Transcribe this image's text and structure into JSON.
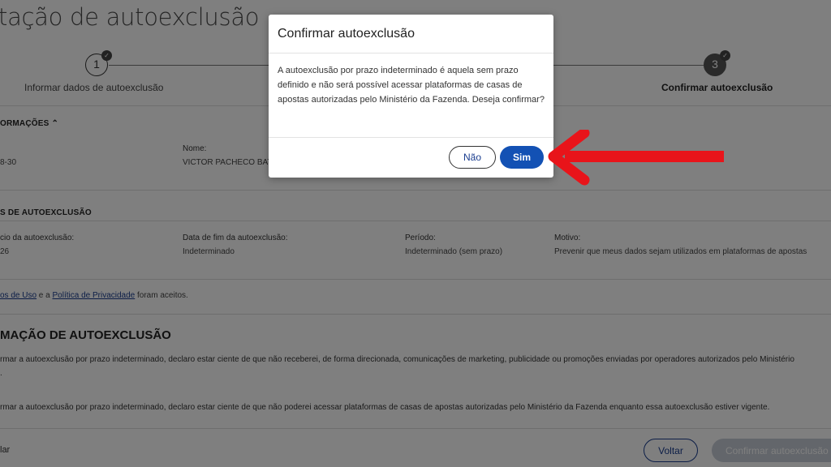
{
  "page": {
    "title": "tação de autoexclusão",
    "steps": [
      {
        "number": "1",
        "label": "Informar dados de autoexclusão"
      },
      {
        "number": "3",
        "label": "Confirmar autoexclusão"
      }
    ],
    "info_section": {
      "heading": "ORMAÇÕES",
      "fields": [
        {
          "value": "8-30"
        },
        {
          "label": "Nome:",
          "value": "VICTOR PACHECO BAT"
        }
      ]
    },
    "autoexclusion_section": {
      "heading": "S DE AUTOEXCLUSÃO",
      "fields": [
        {
          "label": "cio da autoexclusão:",
          "value": "26"
        },
        {
          "label": "Data de fim da autoexclusão:",
          "value": "Indeterminado"
        },
        {
          "label": "Período:",
          "value": "Indeterminado (sem prazo)"
        },
        {
          "label": "Motivo:",
          "value": "Prevenir que meus dados sejam utilizados em plataformas de apostas"
        }
      ]
    },
    "terms": {
      "link1": "os de Uso",
      "connector": " e a ",
      "link2": "Política de Privacidade",
      "suffix": " foram aceitos."
    },
    "declaration": {
      "heading": "MAÇÃO DE AUTOEXCLUSÃO",
      "para1_line1": "rmar a autoexclusão por prazo indeterminado, declaro estar ciente de que não receberei, de forma direcionada, comunicações de marketing, publicidade ou promoções enviadas por operadores autorizados pelo Ministério",
      "para1_line2": ".",
      "para2": "rmar a autoexclusão por prazo indeterminado, declaro estar ciente de que não poderei acessar plataformas de casas de apostas autorizadas pelo Ministério da Fazenda enquanto essa autoexclusão estiver vigente."
    },
    "footer": {
      "back_left": "lar",
      "voltar_label": "Voltar",
      "confirm_label": "Confirmar autoexclusão"
    }
  },
  "modal": {
    "title": "Confirmar autoexclusão",
    "body": "A autoexclusão por prazo indeterminado é aquela sem prazo definido e não será possível acessar plataformas de casas de apostas autorizadas pelo Ministério da Fazenda. Deseja confirmar?",
    "no_label": "Não",
    "yes_label": "Sim"
  },
  "colors": {
    "primary": "#1351b4",
    "overlay": "#000000",
    "arrow": "#e8141a"
  }
}
